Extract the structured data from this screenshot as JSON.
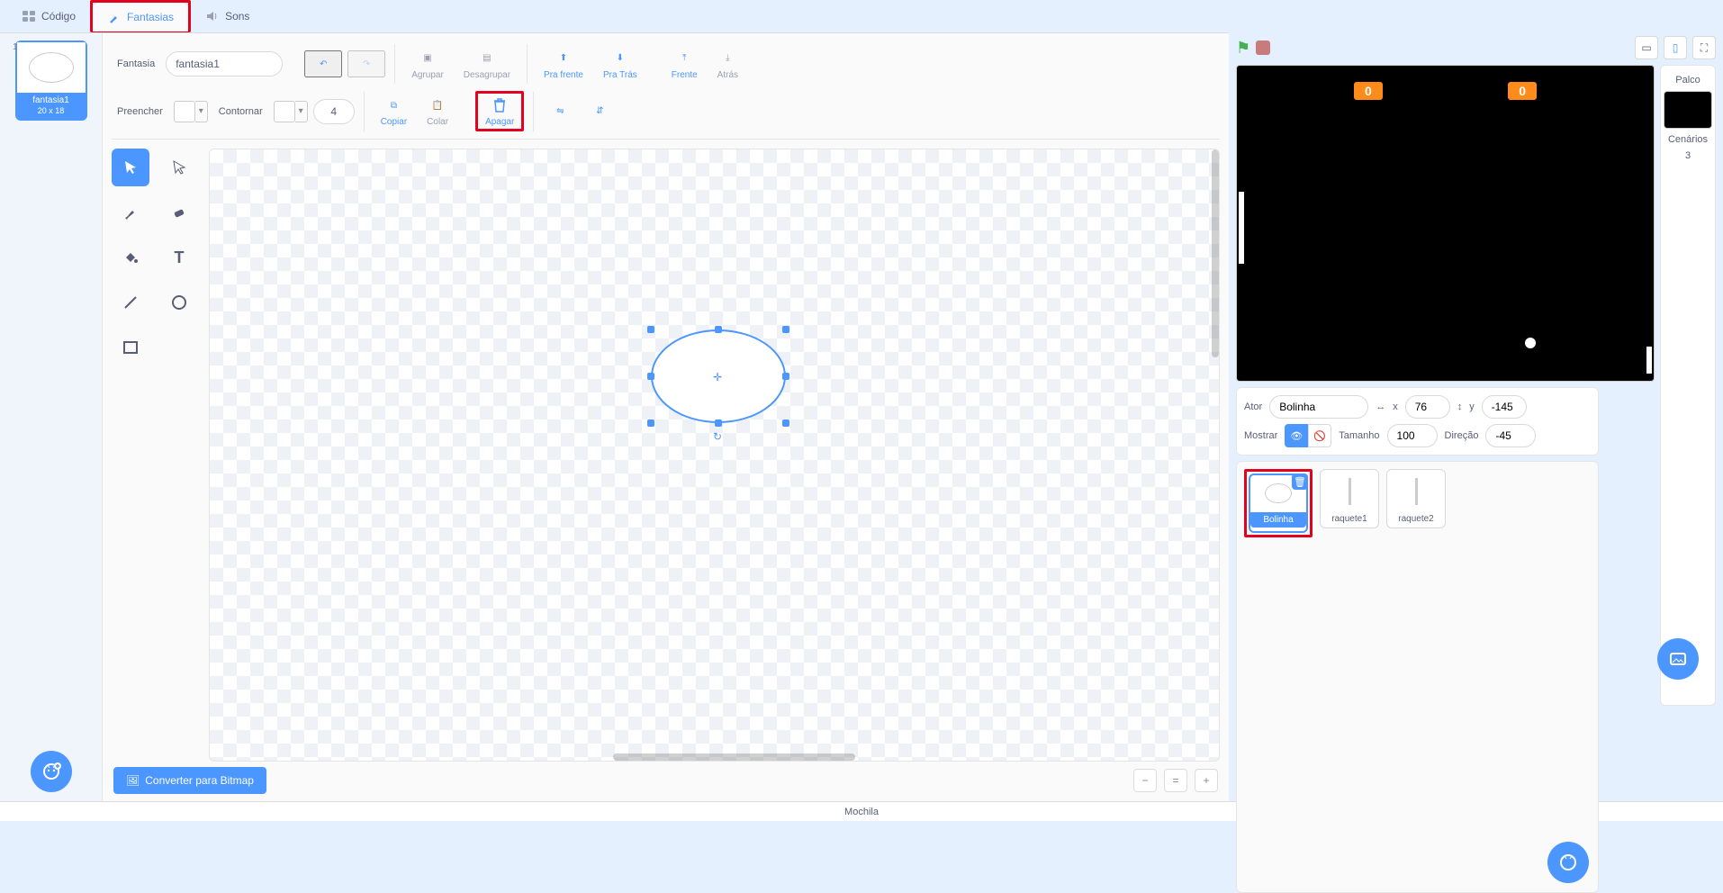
{
  "tabs": {
    "code": "Código",
    "costumes": "Fantasias",
    "sounds": "Sons"
  },
  "costume_item": {
    "index": "1",
    "name": "fantasia1",
    "size": "20 x 18"
  },
  "editor": {
    "fantasia_lbl": "Fantasia",
    "costume_name": "fantasia1",
    "group": "Agrupar",
    "ungroup": "Desagrupar",
    "forward": "Pra frente",
    "backward": "Pra Trás",
    "front": "Frente",
    "back": "Atrás",
    "fill": "Preencher",
    "outline": "Contornar",
    "stroke": "4",
    "copy": "Copiar",
    "paste": "Colar",
    "delete": "Apagar",
    "convert": "Converter para Bitmap"
  },
  "stage_scores": {
    "left": "0",
    "right": "0"
  },
  "sprite": {
    "actor_lbl": "Ator",
    "name": "Bolinha",
    "x_lbl": "x",
    "x": "76",
    "y_lbl": "y",
    "y": "-145",
    "show_lbl": "Mostrar",
    "size_lbl": "Tamanho",
    "size": "100",
    "dir_lbl": "Direção",
    "dir": "-45"
  },
  "sprites": [
    "Bolinha",
    "raquete1",
    "raquete2"
  ],
  "stage_panel": {
    "title": "Palco",
    "scenes_lbl": "Cenários",
    "scenes": "3"
  },
  "backpack": "Mochila"
}
